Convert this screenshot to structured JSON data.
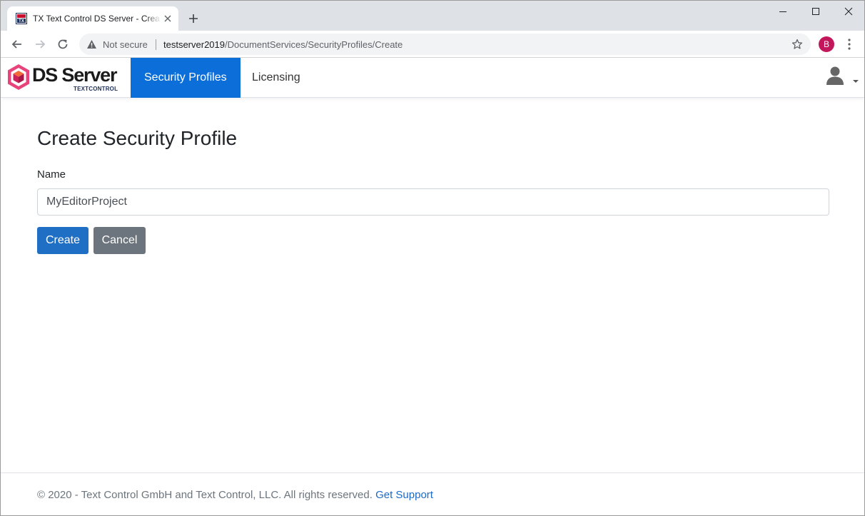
{
  "browser": {
    "tab_title": "TX Text Control DS Server - Create Security Profile",
    "security_label": "Not secure",
    "url_host": "testserver2019",
    "url_path": "/DocumentServices/SecurityProfiles/Create",
    "profile_initial": "B",
    "profile_color": "#c2185b"
  },
  "navbar": {
    "brand_name": "DS Server",
    "brand_tagline": "TEXTCONTROL",
    "items": [
      {
        "label": "Security Profiles",
        "active": true
      },
      {
        "label": "Licensing",
        "active": false
      }
    ],
    "accent_color": "#0b6ed9",
    "user_icon": "user-icon"
  },
  "form": {
    "title": "Create Security Profile",
    "name_label": "Name",
    "name_value": "MyEditorProject",
    "create_label": "Create",
    "cancel_label": "Cancel"
  },
  "footer": {
    "copyright": "© 2020 - Text Control GmbH and Text Control, LLC. All rights reserved.",
    "support_link": "Get Support"
  }
}
